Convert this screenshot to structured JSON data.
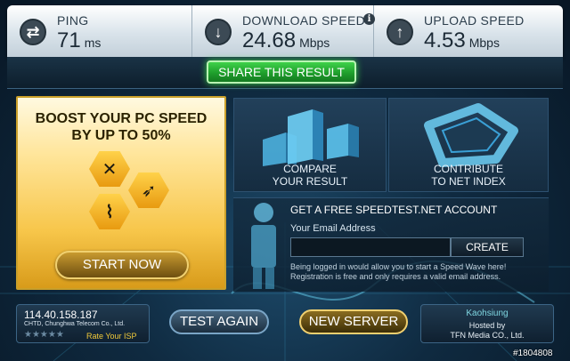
{
  "stats": {
    "ping": {
      "label": "PING",
      "value": "71",
      "unit": "ms",
      "icon": "swap-arrows-icon"
    },
    "download": {
      "label": "DOWNLOAD SPEED",
      "value": "24.68",
      "unit": "Mbps",
      "icon": "arrow-down-icon",
      "info": "i"
    },
    "upload": {
      "label": "UPLOAD SPEED",
      "value": "4.53",
      "unit": "Mbps",
      "icon": "arrow-up-icon"
    }
  },
  "share": {
    "label": "SHARE THIS RESULT"
  },
  "promo": {
    "title_line1": "BOOST YOUR PC SPEED",
    "title_line2": "BY UP TO 50%",
    "button": "START NOW"
  },
  "tiles": {
    "compare": {
      "line1": "COMPARE",
      "line2": "YOUR RESULT"
    },
    "contribute": {
      "line1": "CONTRIBUTE",
      "line2": "TO NET INDEX"
    }
  },
  "account": {
    "heading": "GET A FREE SPEEDTEST.NET ACCOUNT",
    "email_label": "Your Email Address",
    "email_value": "",
    "create": "CREATE",
    "note_line1": "Being logged in would allow you to start a Speed Wave here!",
    "note_line2": "Registration is free and only requires a valid email address."
  },
  "isp": {
    "ip": "114.40.158.187",
    "name": "CHTD, Chunghwa Telecom Co., Ltd.",
    "stars": "★★★★★",
    "rate": "Rate Your ISP"
  },
  "buttons": {
    "test_again": "TEST AGAIN",
    "new_server": "NEW SERVER"
  },
  "server": {
    "city": "Kaohsiung",
    "hosted": "Hosted by",
    "host": "TFN Media CO., Ltd."
  },
  "watermark": "#1804808",
  "colors": {
    "accent_green": "#2fb83a",
    "promo_gold": "#f7c64a",
    "server_city": "#7fd6e0"
  }
}
